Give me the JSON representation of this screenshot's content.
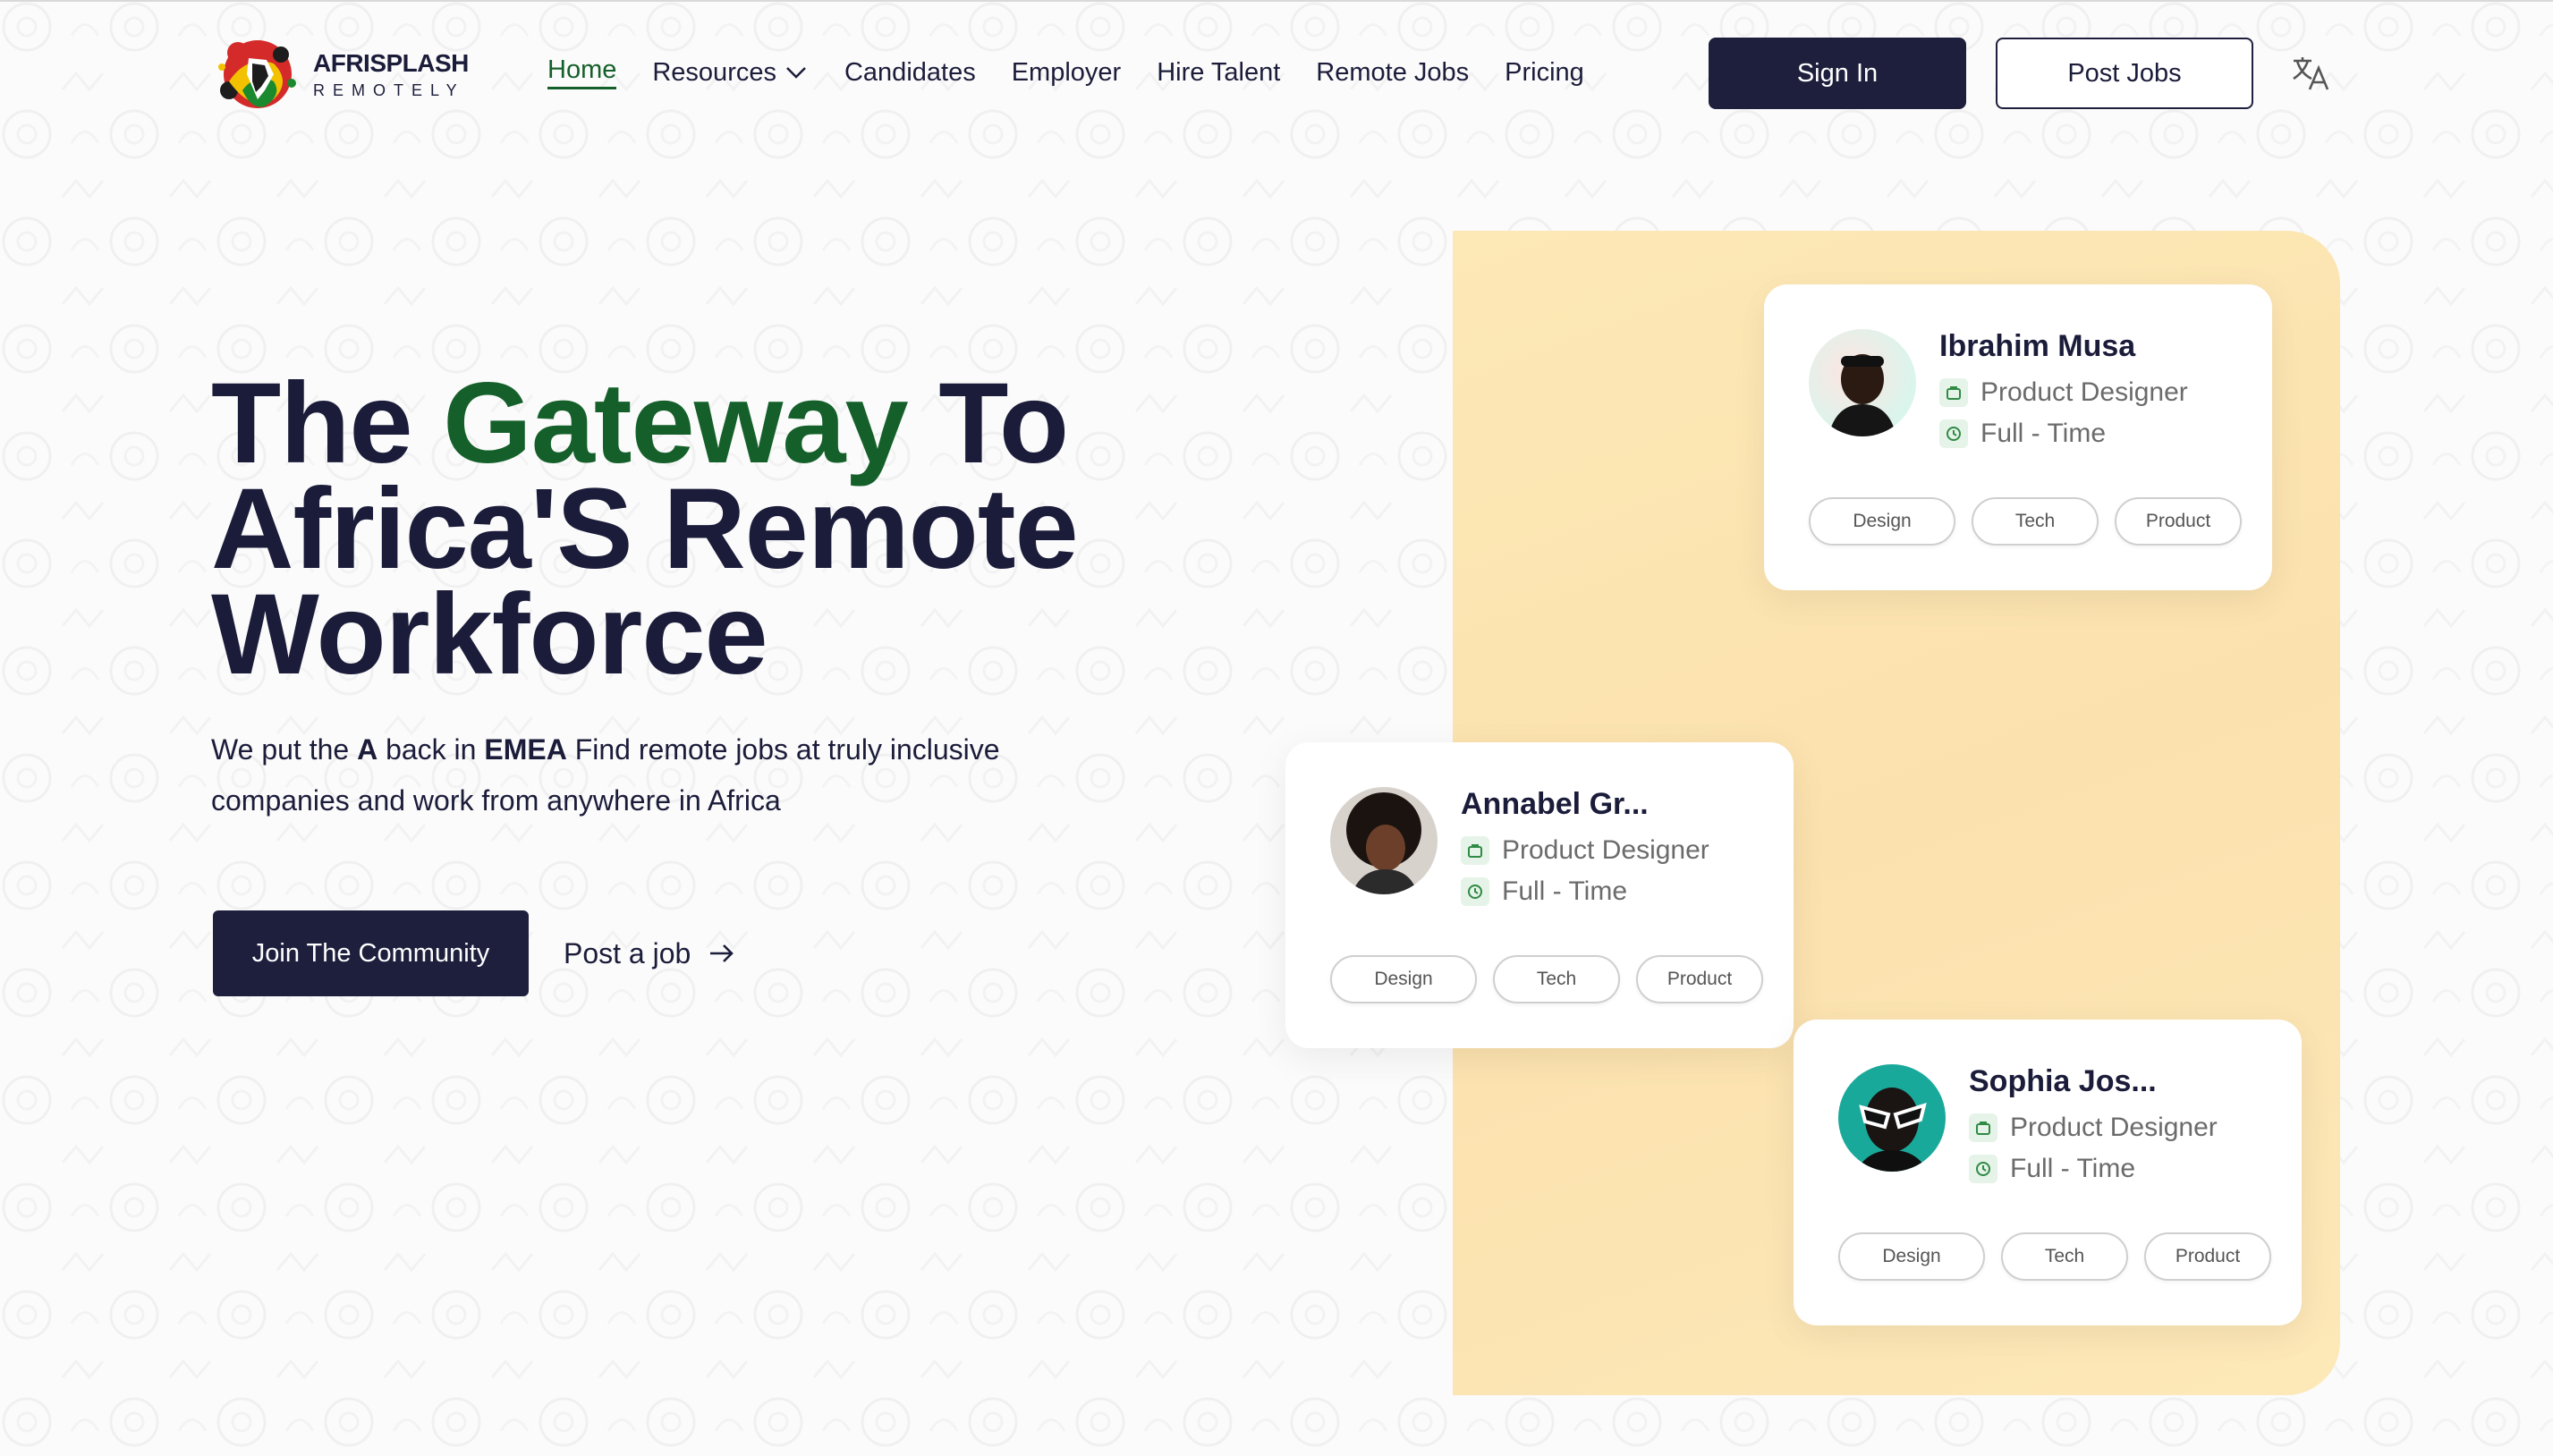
{
  "brand": {
    "name": "AFRISPLASH",
    "tagline": "REMOTELY"
  },
  "nav": {
    "items": [
      {
        "label": "Home",
        "active": true
      },
      {
        "label": "Resources",
        "has_dropdown": true
      },
      {
        "label": "Candidates"
      },
      {
        "label": "Employer"
      },
      {
        "label": "Hire Talent"
      },
      {
        "label": "Remote Jobs"
      },
      {
        "label": "Pricing"
      }
    ],
    "sign_in": "Sign In",
    "post_jobs": "Post Jobs",
    "language_icon": "translate-icon"
  },
  "hero": {
    "title_part1": "The ",
    "title_accent": "Gateway",
    "title_part2": " To Africa'S Remote Workforce",
    "subtitle_1": "We put the ",
    "subtitle_bold1": "A",
    "subtitle_2": " back in ",
    "subtitle_bold2": "EMEA",
    "subtitle_3": " Find remote jobs at truly inclusive companies and work from anywhere in Africa",
    "cta_primary": "Join The Community",
    "cta_secondary": "Post a job"
  },
  "cards": [
    {
      "name": "Ibrahim Musa",
      "role": "Product Designer",
      "type": "Full - Time",
      "tags": [
        "Design",
        "Tech",
        "Product"
      ]
    },
    {
      "name": "Annabel Gr...",
      "role": "Product Designer",
      "type": "Full - Time",
      "tags": [
        "Design",
        "Tech",
        "Product"
      ]
    },
    {
      "name": "Sophia Jos...",
      "role": "Product Designer",
      "type": "Full - Time",
      "tags": [
        "Design",
        "Tech",
        "Product"
      ]
    }
  ],
  "colors": {
    "navy": "#1d1f3d",
    "green": "#15602a",
    "panel": "#fde6b2"
  }
}
